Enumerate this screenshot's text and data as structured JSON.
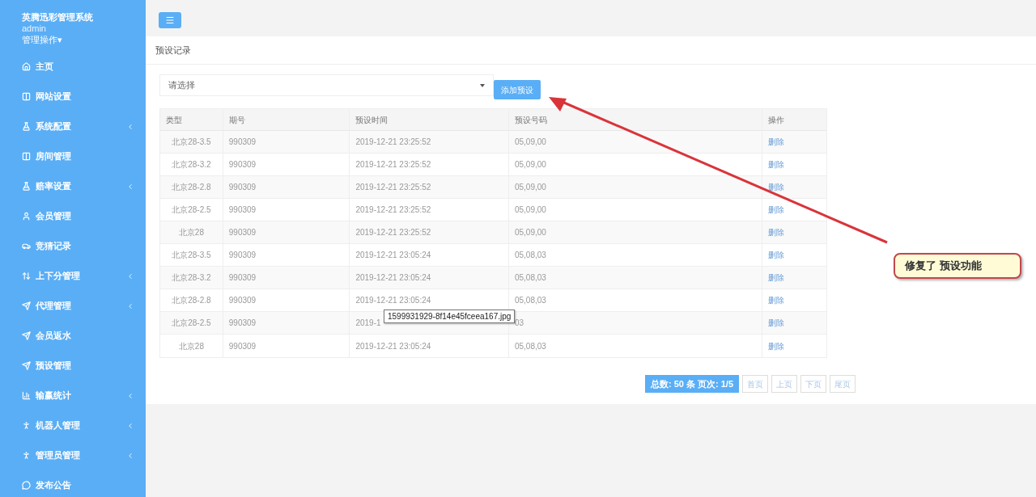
{
  "sidebar": {
    "title": "英腾迅彩管理系统",
    "user": "admin",
    "user_menu": "管理操作▾",
    "items": [
      {
        "label": "主页",
        "has_submenu": false
      },
      {
        "label": "网站设置",
        "has_submenu": false
      },
      {
        "label": "系统配置",
        "has_submenu": true
      },
      {
        "label": "房间管理",
        "has_submenu": false
      },
      {
        "label": "赔率设置",
        "has_submenu": true
      },
      {
        "label": "会员管理",
        "has_submenu": false
      },
      {
        "label": "竞猜记录",
        "has_submenu": false
      },
      {
        "label": "上下分管理",
        "has_submenu": true
      },
      {
        "label": "代理管理",
        "has_submenu": true
      },
      {
        "label": "会员返水",
        "has_submenu": false
      },
      {
        "label": "预设管理",
        "has_submenu": false
      },
      {
        "label": "输赢统计",
        "has_submenu": true
      },
      {
        "label": "机器人管理",
        "has_submenu": true
      },
      {
        "label": "管理员管理",
        "has_submenu": true
      },
      {
        "label": "发布公告",
        "has_submenu": false
      }
    ]
  },
  "panel": {
    "title": "预设记录",
    "select": {
      "value": "请选择"
    },
    "add_button": "添加预设",
    "table": {
      "columns": [
        "类型",
        "期号",
        "预设时间",
        "预设号码",
        "操作"
      ],
      "rows": [
        [
          "北京28-3.5",
          "990309",
          "2019-12-21 23:25:52",
          "05,09,00",
          "删除"
        ],
        [
          "北京28-3.2",
          "990309",
          "2019-12-21 23:25:52",
          "05,09,00",
          "删除"
        ],
        [
          "北京28-2.8",
          "990309",
          "2019-12-21 23:25:52",
          "05,09,00",
          "删除"
        ],
        [
          "北京28-2.5",
          "990309",
          "2019-12-21 23:25:52",
          "05,09,00",
          "删除"
        ],
        [
          "北京28",
          "990309",
          "2019-12-21 23:25:52",
          "05,09,00",
          "删除"
        ],
        [
          "北京28-3.5",
          "990309",
          "2019-12-21 23:05:24",
          "05,08,03",
          "删除"
        ],
        [
          "北京28-3.2",
          "990309",
          "2019-12-21 23:05:24",
          "05,08,03",
          "删除"
        ],
        [
          "北京28-2.8",
          "990309",
          "2019-12-21 23:05:24",
          "05,08,03",
          "删除"
        ],
        [
          "北京28-2.5",
          "990309",
          "2019-1",
          "03",
          "删除"
        ],
        [
          "北京28",
          "990309",
          "2019-12-21 23:05:24",
          "05,08,03",
          "删除"
        ]
      ]
    },
    "pagination": {
      "summary": "总数: 50 条 页次: 1/5",
      "buttons": [
        "首页",
        "上页",
        "下页",
        "尾页"
      ]
    }
  },
  "tooltip": "1599931929-8f14e45fceea167.jpg",
  "callout": "修复了 预设功能"
}
